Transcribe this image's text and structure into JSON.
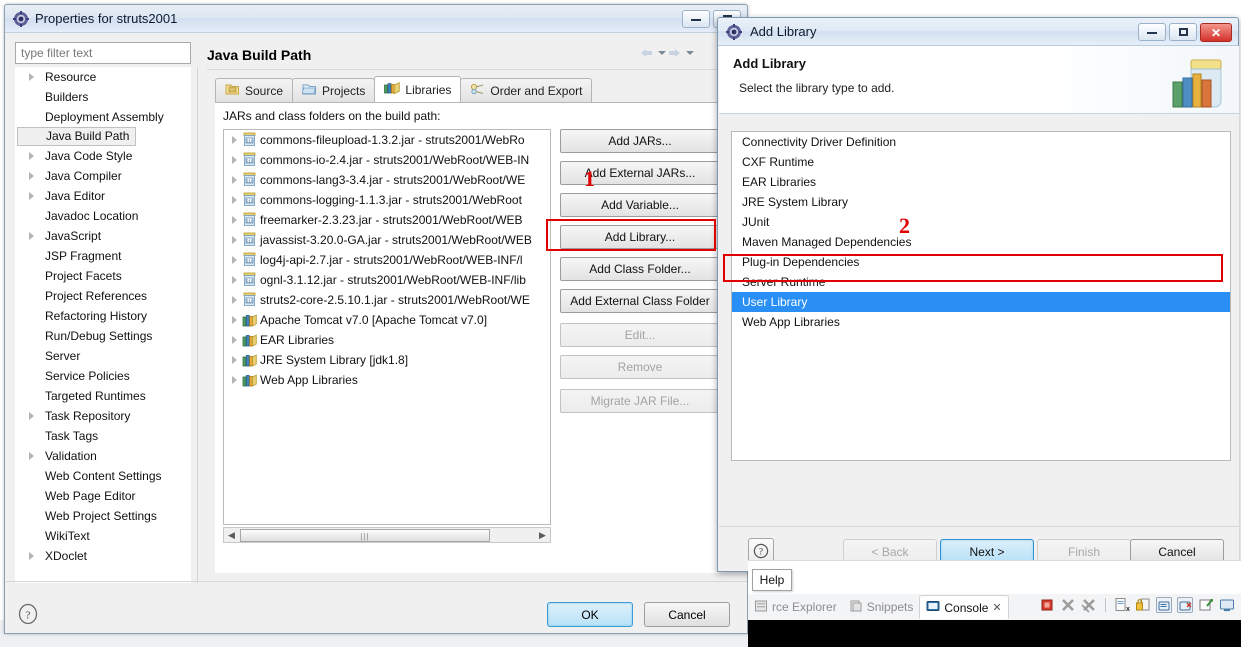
{
  "properties_dialog": {
    "title": "Properties for struts2001",
    "title_icon": "eclipse-properties-icon",
    "window_buttons": {
      "minimize": "minimize-button",
      "maximize": "maximize-button"
    },
    "filter": {
      "placeholder": "type filter text",
      "value": ""
    },
    "tree_items": [
      {
        "label": "Resource",
        "expandable": true,
        "selected": false
      },
      {
        "label": "Builders",
        "expandable": false,
        "selected": false
      },
      {
        "label": "Deployment Assembly",
        "expandable": false,
        "selected": false
      },
      {
        "label": "Java Build Path",
        "expandable": false,
        "selected": true
      },
      {
        "label": "Java Code Style",
        "expandable": true,
        "selected": false
      },
      {
        "label": "Java Compiler",
        "expandable": true,
        "selected": false
      },
      {
        "label": "Java Editor",
        "expandable": true,
        "selected": false
      },
      {
        "label": "Javadoc Location",
        "expandable": false,
        "selected": false
      },
      {
        "label": "JavaScript",
        "expandable": true,
        "selected": false
      },
      {
        "label": "JSP Fragment",
        "expandable": false,
        "selected": false
      },
      {
        "label": "Project Facets",
        "expandable": false,
        "selected": false
      },
      {
        "label": "Project References",
        "expandable": false,
        "selected": false
      },
      {
        "label": "Refactoring History",
        "expandable": false,
        "selected": false
      },
      {
        "label": "Run/Debug Settings",
        "expandable": false,
        "selected": false
      },
      {
        "label": "Server",
        "expandable": false,
        "selected": false
      },
      {
        "label": "Service Policies",
        "expandable": false,
        "selected": false
      },
      {
        "label": "Targeted Runtimes",
        "expandable": false,
        "selected": false
      },
      {
        "label": "Task Repository",
        "expandable": true,
        "selected": false
      },
      {
        "label": "Task Tags",
        "expandable": false,
        "selected": false
      },
      {
        "label": "Validation",
        "expandable": true,
        "selected": false
      },
      {
        "label": "Web Content Settings",
        "expandable": false,
        "selected": false
      },
      {
        "label": "Web Page Editor",
        "expandable": false,
        "selected": false
      },
      {
        "label": "Web Project Settings",
        "expandable": false,
        "selected": false
      },
      {
        "label": "WikiText",
        "expandable": false,
        "selected": false
      },
      {
        "label": "XDoclet",
        "expandable": true,
        "selected": false
      }
    ],
    "page_title": "Java Build Path",
    "tabs": [
      {
        "label": "Source",
        "icon": "source-folder-icon",
        "active": false
      },
      {
        "label": "Projects",
        "icon": "projects-folder-icon",
        "active": false
      },
      {
        "label": "Libraries",
        "icon": "libraries-books-icon",
        "active": true
      },
      {
        "label": "Order and Export",
        "icon": "order-export-icon",
        "active": false
      }
    ],
    "libraries_tab": {
      "list_label": "JARs and class folders on the build path:",
      "entries": [
        {
          "label": "commons-fileupload-1.3.2.jar - struts2001/WebRo",
          "icon": "jar-icon"
        },
        {
          "label": "commons-io-2.4.jar - struts2001/WebRoot/WEB-IN",
          "icon": "jar-icon"
        },
        {
          "label": "commons-lang3-3.4.jar - struts2001/WebRoot/WE",
          "icon": "jar-icon"
        },
        {
          "label": "commons-logging-1.1.3.jar - struts2001/WebRoot",
          "icon": "jar-icon"
        },
        {
          "label": "freemarker-2.3.23.jar - struts2001/WebRoot/WEB",
          "icon": "jar-icon"
        },
        {
          "label": "javassist-3.20.0-GA.jar - struts2001/WebRoot/WEB",
          "icon": "jar-icon"
        },
        {
          "label": "log4j-api-2.7.jar - struts2001/WebRoot/WEB-INF/l",
          "icon": "jar-icon"
        },
        {
          "label": "ognl-3.1.12.jar - struts2001/WebRoot/WEB-INF/lib",
          "icon": "jar-icon"
        },
        {
          "label": "struts2-core-2.5.10.1.jar - struts2001/WebRoot/WE",
          "icon": "jar-icon"
        },
        {
          "label": "Apache Tomcat v7.0 [Apache Tomcat v7.0]",
          "icon": "library-icon"
        },
        {
          "label": "EAR Libraries",
          "icon": "library-icon"
        },
        {
          "label": "JRE System Library [jdk1.8]",
          "icon": "library-icon"
        },
        {
          "label": "Web App Libraries",
          "icon": "library-icon"
        }
      ],
      "buttons": [
        {
          "label": "Add JARs...",
          "enabled": true
        },
        {
          "label": "Add External JARs...",
          "enabled": true
        },
        {
          "label": "Add Variable...",
          "enabled": true
        },
        {
          "label": "Add Library...",
          "enabled": true
        },
        {
          "label": "Add Class Folder...",
          "enabled": true
        },
        {
          "label": "Add External Class Folder",
          "enabled": true
        },
        {
          "label": "Edit...",
          "enabled": false
        },
        {
          "label": "Remove",
          "enabled": false
        },
        {
          "label": "Migrate JAR File...",
          "enabled": false
        }
      ]
    },
    "footer": {
      "help_icon": "help-question-icon",
      "ok_label": "OK",
      "cancel_label": "Cancel"
    }
  },
  "add_library_dialog": {
    "title": "Add Library",
    "title_icon": "eclipse-wizard-icon",
    "window_buttons": {
      "minimize": "minimize-button",
      "maximize": "maximize-button",
      "close": "close-button"
    },
    "header_title": "Add Library",
    "header_subtitle": "Select the library type to add.",
    "header_icon": "jar-with-books-icon",
    "library_types": [
      {
        "label": "Connectivity Driver Definition",
        "selected": false
      },
      {
        "label": "CXF Runtime",
        "selected": false
      },
      {
        "label": "EAR Libraries",
        "selected": false
      },
      {
        "label": "JRE System Library",
        "selected": false
      },
      {
        "label": "JUnit",
        "selected": false
      },
      {
        "label": "Maven Managed Dependencies",
        "selected": false
      },
      {
        "label": "Plug-in Dependencies",
        "selected": false
      },
      {
        "label": "Server Runtime",
        "selected": false
      },
      {
        "label": "User Library",
        "selected": true
      },
      {
        "label": "Web App Libraries",
        "selected": false
      }
    ],
    "footer": {
      "help_icon": "help-question-icon",
      "back_label": "< Back",
      "next_label": "Next >",
      "finish_label": "Finish",
      "cancel_label": "Cancel"
    }
  },
  "annotations": [
    {
      "number": "1",
      "target": "add-external-jars-button"
    },
    {
      "number": "2",
      "target": "user-library-list-item"
    }
  ],
  "eclipse_bottom": {
    "tooltip": "Help",
    "tabs": [
      {
        "label": "rce Explorer",
        "active": false,
        "icon": "explorer-icon"
      },
      {
        "label": "Snippets",
        "active": false,
        "icon": "snippets-icon"
      },
      {
        "label": "Console",
        "active": true,
        "icon": "console-icon",
        "closeable": true
      }
    ],
    "toolbar_icons": [
      "terminate-icon",
      "remove-launch-icon",
      "remove-all-launches-icon",
      "clear-console-icon",
      "scroll-lock-icon",
      "pin-console-icon",
      "display-selected-console-icon",
      "open-console-icon",
      "new-console-view-icon"
    ]
  },
  "colors": {
    "selection_blue": "#2a8ff5",
    "annotation_red": "#e00000",
    "primary_button_border": "#2f93d1",
    "titlebar_blue": "#dfe9f4"
  }
}
